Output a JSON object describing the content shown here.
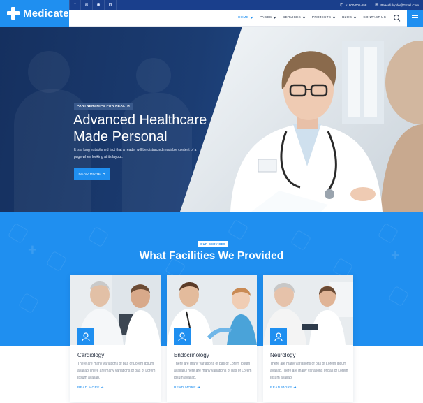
{
  "brand": {
    "name": "Medicate"
  },
  "topbar": {
    "social": [
      "f",
      "◎",
      "◉",
      "in"
    ],
    "phone": "+1800-001-658",
    "email": "Peacefulqode@Gmail.Com"
  },
  "nav": {
    "items": [
      "HOME",
      "PAGES",
      "SERVICES",
      "PROJECTS",
      "BLOG",
      "CONTACT US"
    ],
    "active": "HOME"
  },
  "hero": {
    "badge": "PARTNERSHIPS FOR HEALTH",
    "title_line1": "Advanced Healthcare",
    "title_line2": "Made Personal",
    "description": "It is a long established fact that a reader will be distracted readable content of a page when looking at its layout.",
    "button": "READ MORE"
  },
  "services": {
    "badge": "OUR SERVICES",
    "title": "What Facilities We Provided",
    "cards": [
      {
        "name": "Cardiology",
        "description": "There are many variations of pas of Lorem Ipsum availab.There are many variations of pas of Lorem Ipsum availab.",
        "link": "READ MORE"
      },
      {
        "name": "Endocrinology",
        "description": "There are many variations of pas of Lorem Ipsum availab.There are many variations of pas of Lorem Ipsum availab.",
        "link": "READ MORE"
      },
      {
        "name": "Neurology",
        "description": "There are many variations of pas of Lorem Ipsum availab.There are many variations of pas of Lorem Ipsum availab.",
        "link": "READ MORE"
      }
    ]
  },
  "colors": {
    "primary": "#1f8ff0",
    "topbar": "#1a3f8c",
    "hero_dark": "#163467",
    "heading": "#1d2738",
    "text": "#7c8696"
  }
}
